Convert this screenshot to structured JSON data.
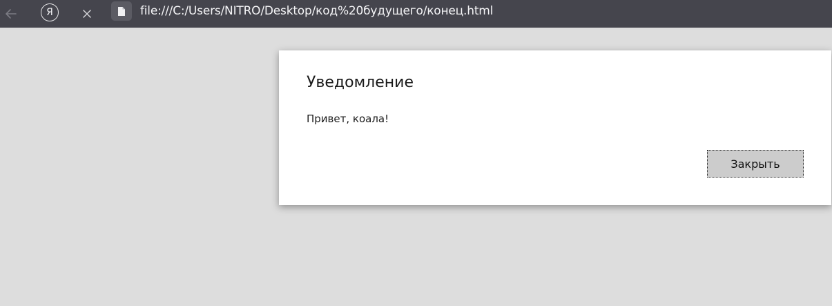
{
  "browser": {
    "url": "file:///C:/Users/NITRO/Desktop/код%20будущего/конец.html",
    "yandex_glyph": "Я",
    "colors": {
      "toolbar_bg": "#45454d",
      "page_bg": "#dddddd"
    },
    "icons": [
      "back-arrow-icon",
      "yandex-icon",
      "close-icon",
      "file-icon"
    ]
  },
  "dialog": {
    "title": "Уведомление",
    "message": "Привет, коала!",
    "button_label": "Закрыть",
    "colors": {
      "background": "#ffffff",
      "button_bg": "#cccccc"
    }
  }
}
